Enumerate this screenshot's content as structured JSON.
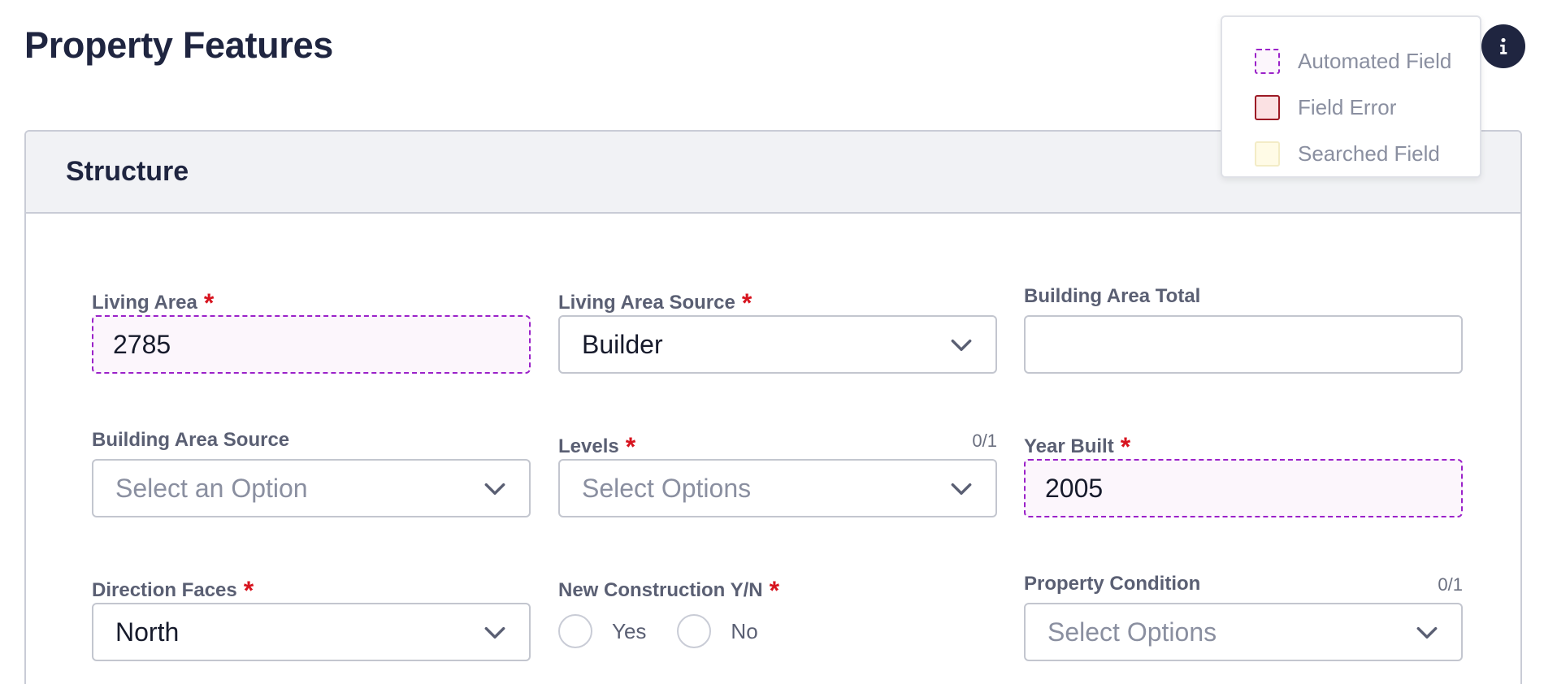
{
  "page": {
    "title": "Property Features"
  },
  "legend": {
    "items": [
      {
        "key": "automated",
        "label": "Automated Field"
      },
      {
        "key": "error",
        "label": "Field Error"
      },
      {
        "key": "searched",
        "label": "Searched Field"
      }
    ]
  },
  "section": {
    "title": "Structure"
  },
  "fields": {
    "living_area": {
      "label": "Living Area",
      "value": "2785"
    },
    "living_area_source": {
      "label": "Living Area Source",
      "value": "Builder"
    },
    "building_area_total": {
      "label": "Building Area Total",
      "value": ""
    },
    "building_area_source": {
      "label": "Building Area Source",
      "placeholder": "Select an Option"
    },
    "levels": {
      "label": "Levels",
      "placeholder": "Select Options",
      "counter": "0/1"
    },
    "year_built": {
      "label": "Year Built",
      "value": "2005"
    },
    "direction_faces": {
      "label": "Direction Faces",
      "value": "North"
    },
    "new_construction": {
      "label": "New Construction Y/N",
      "options": [
        "Yes",
        "No"
      ]
    },
    "property_condition": {
      "label": "Property Condition",
      "placeholder": "Select Options",
      "counter": "0/1"
    }
  },
  "required_marker": "*",
  "colors": {
    "title": "#1f2540",
    "required": "#d7141f",
    "automated_border": "#9b22c9",
    "automated_fill": "#fcf6fc",
    "error_border": "#9c1a25",
    "error_fill": "#fbe1e3",
    "searched_fill": "#fffbe6",
    "info_button": "#1f2540"
  },
  "icons": {
    "info": "info-icon",
    "dropdown": "chevron-down-icon"
  }
}
